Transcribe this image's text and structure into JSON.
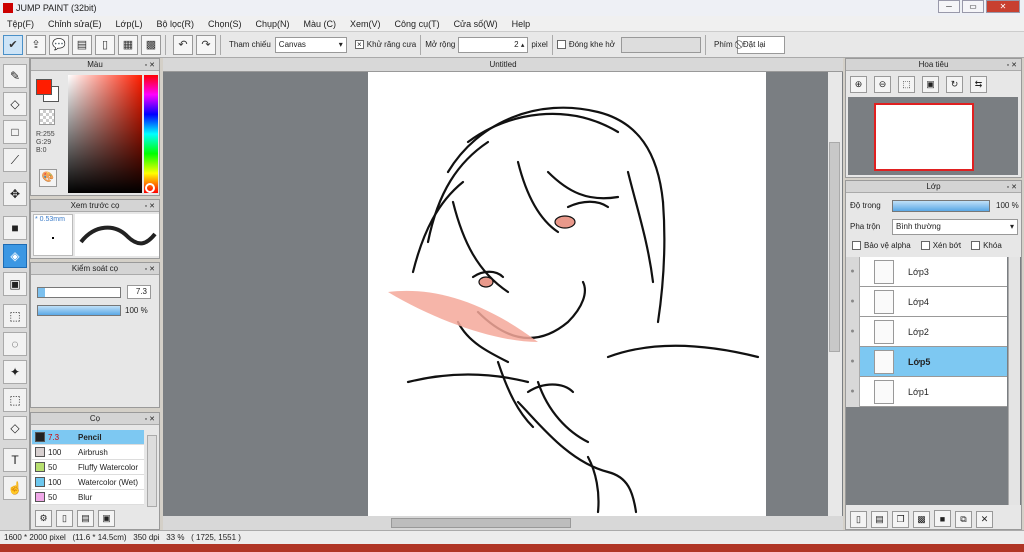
{
  "window": {
    "title": "JUMP PAINT (32bit)",
    "minimize": "─",
    "maximize": "▭",
    "close": "✕"
  },
  "menu": [
    "Tệp(F)",
    "Chỉnh sửa(E)",
    "Lớp(L)",
    "Bộ lọc(R)",
    "Chọn(S)",
    "Chụp(N)",
    "Màu (C)",
    "Xem(V)",
    "Công cụ(T)",
    "Cửa số(W)",
    "Help"
  ],
  "toolbar": {
    "reference_label": "Tham chiếu",
    "reference_value": "Canvas",
    "antialias_label": "Khử răng cưa",
    "expand_label": "Mở rộng",
    "expand_value": "2",
    "expand_unit": "pixel",
    "close_gap_label": "Đóng khe hở",
    "key_label": "Phím",
    "reset_label": "Đặt lại"
  },
  "color_panel": {
    "title": "Màu",
    "rgb": {
      "r": "R:255",
      "g": "G:29",
      "b": "B:0"
    },
    "foreground": "#ff1d00",
    "background": "#ffffff"
  },
  "brush_preview": {
    "title": "Xem trước cọ",
    "size": "* 0.53mm"
  },
  "brush_control": {
    "title": "Kiểm soát cọ",
    "size_value": "7.3",
    "size_fill": 0.08,
    "opacity_value": "100 %",
    "opacity_fill": 1.0
  },
  "brush_list": {
    "title": "Cọ",
    "items": [
      {
        "size": "7.3",
        "name": "Pencil",
        "color": "#222222",
        "selected": true
      },
      {
        "size": "100",
        "name": "Airbrush",
        "color": "#d8d0d0",
        "selected": false
      },
      {
        "size": "50",
        "name": "Fluffy Watercolor",
        "color": "#b8e070",
        "selected": false
      },
      {
        "size": "100",
        "name": "Watercolor (Wet)",
        "color": "#6ec8ef",
        "selected": false
      },
      {
        "size": "50",
        "name": "Blur",
        "color": "#f0a8e8",
        "selected": false
      }
    ]
  },
  "document": {
    "tab_title": "Untitled"
  },
  "navigator": {
    "title": "Hoa tiêu"
  },
  "layers_panel": {
    "title": "Lớp",
    "opacity_label": "Độ trong",
    "opacity_value": "100 %",
    "opacity_fill": 1.0,
    "blend_label": "Pha trộn",
    "blend_value": "Bình thường",
    "protect_alpha": "Bảo vệ alpha",
    "clip": "Xén bớt",
    "lock": "Khóa",
    "layers": [
      {
        "name": "Lớp3",
        "selected": false
      },
      {
        "name": "Lớp4",
        "selected": false
      },
      {
        "name": "Lớp2",
        "selected": false
      },
      {
        "name": "Lớp5",
        "selected": true
      },
      {
        "name": "Lớp1",
        "selected": false
      }
    ]
  },
  "status": {
    "size": "1600 * 2000 pixel",
    "physical": "(11.6 * 14.5cm)",
    "dpi": "350 dpi",
    "zoom": "33 %",
    "cursor": "( 1725, 1551 )"
  }
}
